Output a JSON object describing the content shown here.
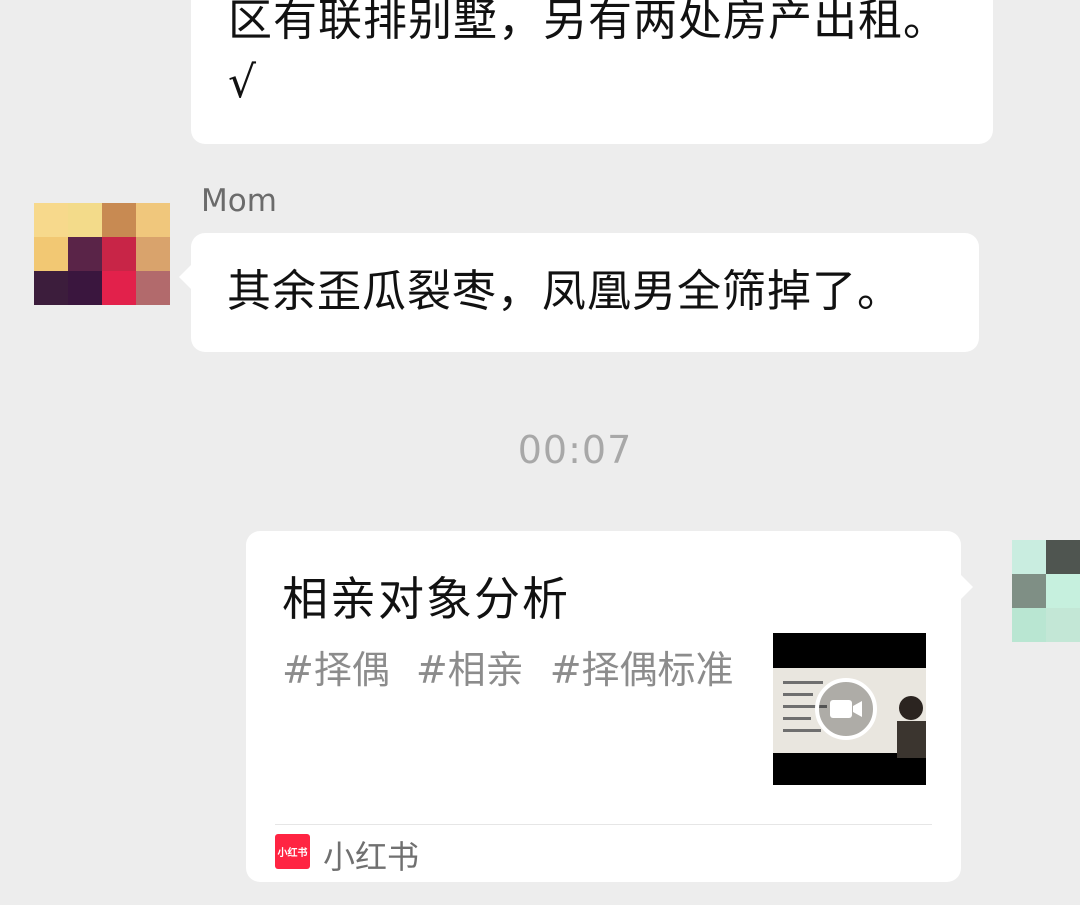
{
  "messages": {
    "prev_text": "区有联排别墅，另有两处房产出租。√",
    "sender_name": "Mom",
    "second_text": "其余歪瓜裂枣，凤凰男全筛掉了。"
  },
  "timestamp": "00:07",
  "card": {
    "title": "相亲对象分析",
    "tags": [
      "#择偶",
      "#相亲",
      "#择偶标准"
    ],
    "source_logo_text": "小红书",
    "source_name": "小红书",
    "thumbnail_icon": "video-camera-icon"
  },
  "colors": {
    "background": "#ededed",
    "bubble": "#ffffff",
    "brand": "#ff2442"
  }
}
